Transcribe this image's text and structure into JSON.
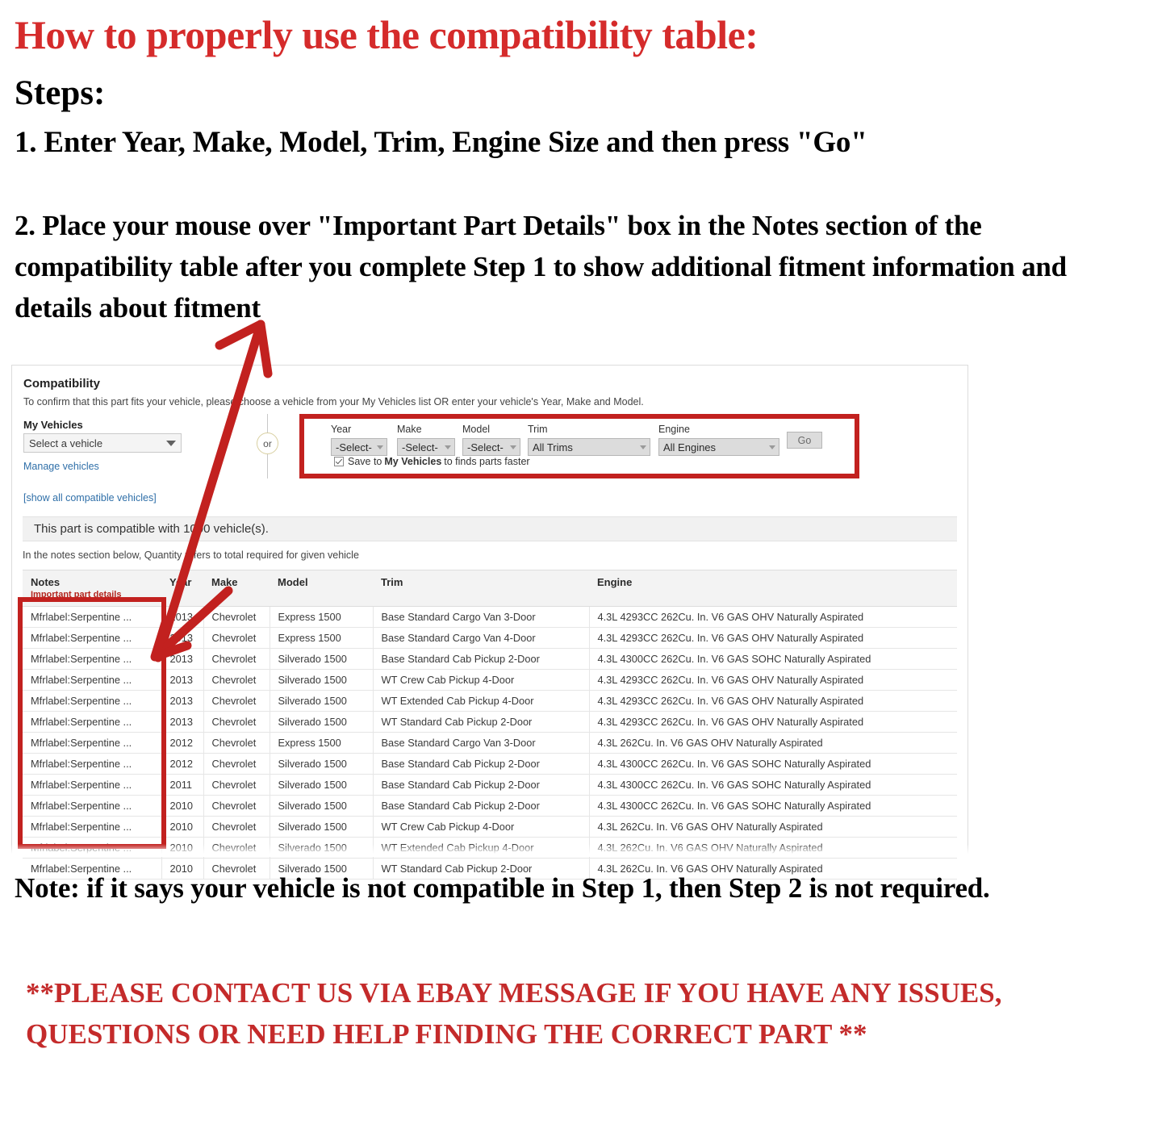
{
  "instructions": {
    "headline": "How to properly use the compatibility table:",
    "steps_label": "Steps:",
    "step_one": "1. Enter Year, Make, Model, Trim, Engine Size and then press \"Go\"",
    "step_two": "2. Place your mouse over \"Important Part Details\" box in the Notes section of the compatibility table after you complete Step 1 to show additional fitment information and details about fitment",
    "note": "Note: if it says your vehicle is not compatible in Step 1, then Step 2 is not required.",
    "contact": "**PLEASE CONTACT US VIA EBAY MESSAGE IF YOU HAVE ANY ISSUES, QUESTIONS OR NEED HELP FINDING THE CORRECT PART **"
  },
  "colors": {
    "headline_red": "#D52B2B",
    "contact_red": "#C42B2B",
    "highlight_box_red": "#C2211F",
    "arrow_red": "#C2211F",
    "link_blue": "#2f6fa8",
    "notes_sub_red": "#B3261E"
  },
  "panel": {
    "title": "Compatibility",
    "subtitle": "To confirm that this part fits your vehicle, please choose a vehicle from your My Vehicles list OR enter your vehicle's Year, Make and Model.",
    "my_vehicles": {
      "label": "My Vehicles",
      "select_value": "Select a vehicle",
      "manage_link": "Manage vehicles",
      "show_all_link": "[show all compatible vehicles]"
    },
    "or_divider": "or",
    "form": {
      "fields": [
        {
          "label": "Year",
          "value": "-Select-"
        },
        {
          "label": "Make",
          "value": "-Select-"
        },
        {
          "label": "Model",
          "value": "-Select-"
        },
        {
          "label": "Trim",
          "value": "All Trims"
        },
        {
          "label": "Engine",
          "value": "All Engines"
        }
      ],
      "go_button": "Go",
      "save_checkbox": {
        "checked": true,
        "text_before": "Save to",
        "text_bold": "My Vehicles",
        "text_after": "to finds parts faster"
      }
    },
    "compat_banner": "This part is compatible with 1000 vehicle(s).",
    "quantity_note": "In the notes section below, Quantity refers to total required for given vehicle",
    "table": {
      "headers": {
        "notes": "Notes",
        "notes_sub": "Important part details",
        "year": "Year",
        "make": "Make",
        "model": "Model",
        "trim": "Trim",
        "engine": "Engine"
      },
      "rows": [
        {
          "notes": "Mfrlabel:Serpentine ...",
          "year": "2013",
          "make": "Chevrolet",
          "model": "Express 1500",
          "trim": "Base Standard Cargo Van 3-Door",
          "engine": "4.3L 4293CC 262Cu. In. V6 GAS OHV Naturally Aspirated"
        },
        {
          "notes": "Mfrlabel:Serpentine ...",
          "year": "2013",
          "make": "Chevrolet",
          "model": "Express 1500",
          "trim": "Base Standard Cargo Van 4-Door",
          "engine": "4.3L 4293CC 262Cu. In. V6 GAS OHV Naturally Aspirated"
        },
        {
          "notes": "Mfrlabel:Serpentine ...",
          "year": "2013",
          "make": "Chevrolet",
          "model": "Silverado 1500",
          "trim": "Base Standard Cab Pickup 2-Door",
          "engine": "4.3L 4300CC 262Cu. In. V6 GAS SOHC Naturally Aspirated"
        },
        {
          "notes": "Mfrlabel:Serpentine ...",
          "year": "2013",
          "make": "Chevrolet",
          "model": "Silverado 1500",
          "trim": "WT Crew Cab Pickup 4-Door",
          "engine": "4.3L 4293CC 262Cu. In. V6 GAS OHV Naturally Aspirated"
        },
        {
          "notes": "Mfrlabel:Serpentine ...",
          "year": "2013",
          "make": "Chevrolet",
          "model": "Silverado 1500",
          "trim": "WT Extended Cab Pickup 4-Door",
          "engine": "4.3L 4293CC 262Cu. In. V6 GAS OHV Naturally Aspirated"
        },
        {
          "notes": "Mfrlabel:Serpentine ...",
          "year": "2013",
          "make": "Chevrolet",
          "model": "Silverado 1500",
          "trim": "WT Standard Cab Pickup 2-Door",
          "engine": "4.3L 4293CC 262Cu. In. V6 GAS OHV Naturally Aspirated"
        },
        {
          "notes": "Mfrlabel:Serpentine ...",
          "year": "2012",
          "make": "Chevrolet",
          "model": "Express 1500",
          "trim": "Base Standard Cargo Van 3-Door",
          "engine": "4.3L 262Cu. In. V6 GAS OHV Naturally Aspirated"
        },
        {
          "notes": "Mfrlabel:Serpentine ...",
          "year": "2012",
          "make": "Chevrolet",
          "model": "Silverado 1500",
          "trim": "Base Standard Cab Pickup 2-Door",
          "engine": "4.3L 4300CC 262Cu. In. V6 GAS SOHC Naturally Aspirated"
        },
        {
          "notes": "Mfrlabel:Serpentine ...",
          "year": "2011",
          "make": "Chevrolet",
          "model": "Silverado 1500",
          "trim": "Base Standard Cab Pickup 2-Door",
          "engine": "4.3L 4300CC 262Cu. In. V6 GAS SOHC Naturally Aspirated"
        },
        {
          "notes": "Mfrlabel:Serpentine ...",
          "year": "2010",
          "make": "Chevrolet",
          "model": "Silverado 1500",
          "trim": "Base Standard Cab Pickup 2-Door",
          "engine": "4.3L 4300CC 262Cu. In. V6 GAS SOHC Naturally Aspirated"
        },
        {
          "notes": "Mfrlabel:Serpentine ...",
          "year": "2010",
          "make": "Chevrolet",
          "model": "Silverado 1500",
          "trim": "WT Crew Cab Pickup 4-Door",
          "engine": "4.3L 262Cu. In. V6 GAS OHV Naturally Aspirated"
        },
        {
          "notes": "Mfrlabel:Serpentine ...",
          "year": "2010",
          "make": "Chevrolet",
          "model": "Silverado 1500",
          "trim": "WT Extended Cab Pickup 4-Door",
          "engine": "4.3L 262Cu. In. V6 GAS OHV Naturally Aspirated"
        },
        {
          "notes": "Mfrlabel:Serpentine ...",
          "year": "2010",
          "make": "Chevrolet",
          "model": "Silverado 1500",
          "trim": "WT Standard Cab Pickup 2-Door",
          "engine": "4.3L 262Cu. In. V6 GAS OHV Naturally Aspirated"
        }
      ]
    }
  },
  "annotations": {
    "arrow_up_label": "annotation-arrow-to-step2",
    "arrow_down_label": "annotation-arrow-to-notes"
  }
}
